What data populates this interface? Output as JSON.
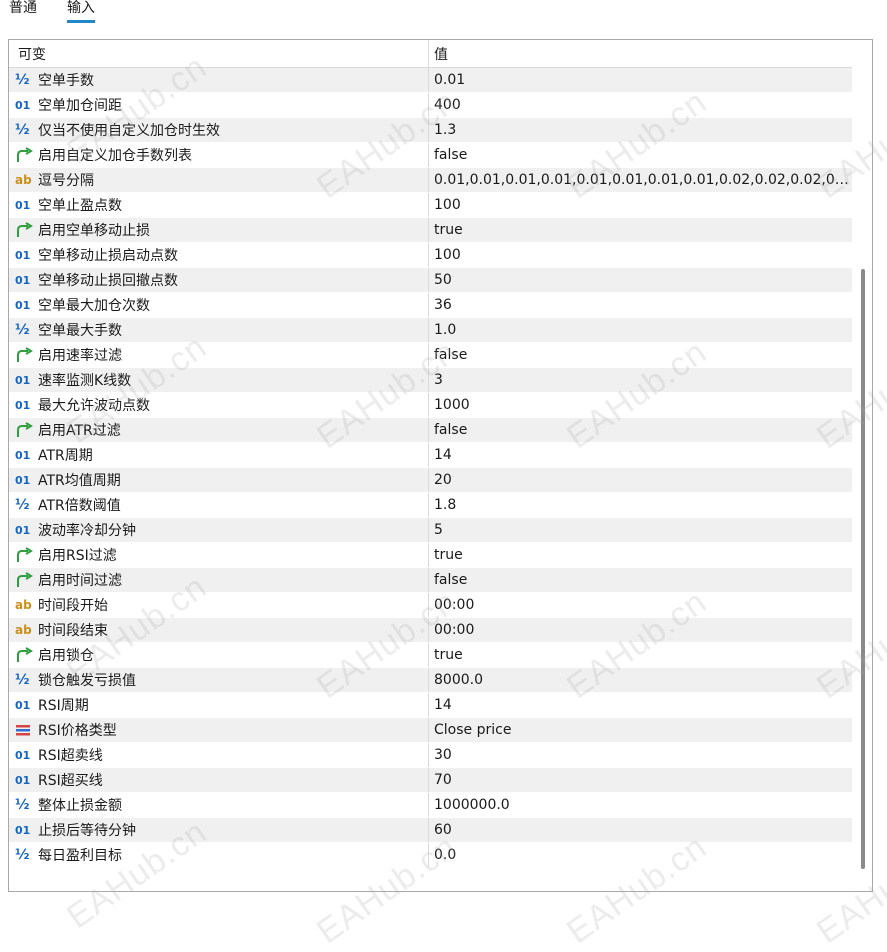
{
  "tabs": [
    {
      "label": "普通",
      "active": false
    },
    {
      "label": "输入",
      "active": true
    }
  ],
  "table": {
    "header": {
      "name": "可变",
      "value": "值"
    },
    "rows": [
      {
        "icon": "double-icon",
        "icon_glyph": "½",
        "name": "空单手数",
        "value": "0.01"
      },
      {
        "icon": "integer-icon",
        "icon_glyph": "01",
        "name": "空单加仓间距",
        "value": "400"
      },
      {
        "icon": "double-icon",
        "icon_glyph": "½",
        "name": "仅当不使用自定义加仓时生效",
        "value": "1.3"
      },
      {
        "icon": "bool-arrow-icon",
        "icon_glyph": "",
        "name": "启用自定义加仓手数列表",
        "value": "false"
      },
      {
        "icon": "string-icon",
        "icon_glyph": "ab",
        "name": "逗号分隔",
        "value": "0.01,0.01,0.01,0.01,0.01,0.01,0.01,0.01,0.02,0.02,0.02,0...."
      },
      {
        "icon": "integer-icon",
        "icon_glyph": "01",
        "name": "空单止盈点数",
        "value": "100"
      },
      {
        "icon": "bool-arrow-icon",
        "icon_glyph": "",
        "name": "启用空单移动止损",
        "value": "true"
      },
      {
        "icon": "integer-icon",
        "icon_glyph": "01",
        "name": "空单移动止损启动点数",
        "value": "100"
      },
      {
        "icon": "integer-icon",
        "icon_glyph": "01",
        "name": "空单移动止损回撤点数",
        "value": "50"
      },
      {
        "icon": "integer-icon",
        "icon_glyph": "01",
        "name": "空单最大加仓次数",
        "value": "36"
      },
      {
        "icon": "double-icon",
        "icon_glyph": "½",
        "name": "空单最大手数",
        "value": "1.0"
      },
      {
        "icon": "bool-arrow-icon",
        "icon_glyph": "",
        "name": "启用速率过滤",
        "value": "false"
      },
      {
        "icon": "integer-icon",
        "icon_glyph": "01",
        "name": "速率监测K线数",
        "value": "3"
      },
      {
        "icon": "integer-icon",
        "icon_glyph": "01",
        "name": "最大允许波动点数",
        "value": "1000"
      },
      {
        "icon": "bool-arrow-icon",
        "icon_glyph": "",
        "name": "启用ATR过滤",
        "value": "false"
      },
      {
        "icon": "integer-icon",
        "icon_glyph": "01",
        "name": "ATR周期",
        "value": "14"
      },
      {
        "icon": "integer-icon",
        "icon_glyph": "01",
        "name": "ATR均值周期",
        "value": "20"
      },
      {
        "icon": "double-icon",
        "icon_glyph": "½",
        "name": "ATR倍数阈值",
        "value": "1.8"
      },
      {
        "icon": "integer-icon",
        "icon_glyph": "01",
        "name": "波动率冷却分钟",
        "value": "5"
      },
      {
        "icon": "bool-arrow-icon",
        "icon_glyph": "",
        "name": "启用RSI过滤",
        "value": "true"
      },
      {
        "icon": "bool-arrow-icon",
        "icon_glyph": "",
        "name": "启用时间过滤",
        "value": "false"
      },
      {
        "icon": "string-icon",
        "icon_glyph": "ab",
        "name": "时间段开始",
        "value": "00:00"
      },
      {
        "icon": "string-icon",
        "icon_glyph": "ab",
        "name": "时间段结束",
        "value": "00:00"
      },
      {
        "icon": "bool-arrow-icon",
        "icon_glyph": "",
        "name": "启用锁仓",
        "value": "true"
      },
      {
        "icon": "double-icon",
        "icon_glyph": "½",
        "name": "锁仓触发亏损值",
        "value": "8000.0"
      },
      {
        "icon": "integer-icon",
        "icon_glyph": "01",
        "name": "RSI周期",
        "value": "14"
      },
      {
        "icon": "enum-list-icon",
        "icon_glyph": "",
        "name": "RSI价格类型",
        "value": "Close price"
      },
      {
        "icon": "integer-icon",
        "icon_glyph": "01",
        "name": "RSI超卖线",
        "value": "30"
      },
      {
        "icon": "integer-icon",
        "icon_glyph": "01",
        "name": "RSI超买线",
        "value": "70"
      },
      {
        "icon": "double-icon",
        "icon_glyph": "½",
        "name": "整体止损金额",
        "value": "1000000.0"
      },
      {
        "icon": "integer-icon",
        "icon_glyph": "01",
        "name": "止损后等待分钟",
        "value": "60"
      },
      {
        "icon": "double-icon",
        "icon_glyph": "½",
        "name": "每日盈利目标",
        "value": "0.0"
      }
    ]
  },
  "watermark": {
    "text": "EAHub.cn"
  },
  "colors": {
    "accent": "#1e88c9",
    "integer_icon": "#1565c0",
    "double_icon": "#1565c0",
    "string_icon": "#c8901e",
    "bool_icon": "#2e9e3e",
    "enum_icon_red": "#d64545",
    "enum_icon_blue": "#2f6fd0",
    "row_alt": "#f0f0f0"
  }
}
